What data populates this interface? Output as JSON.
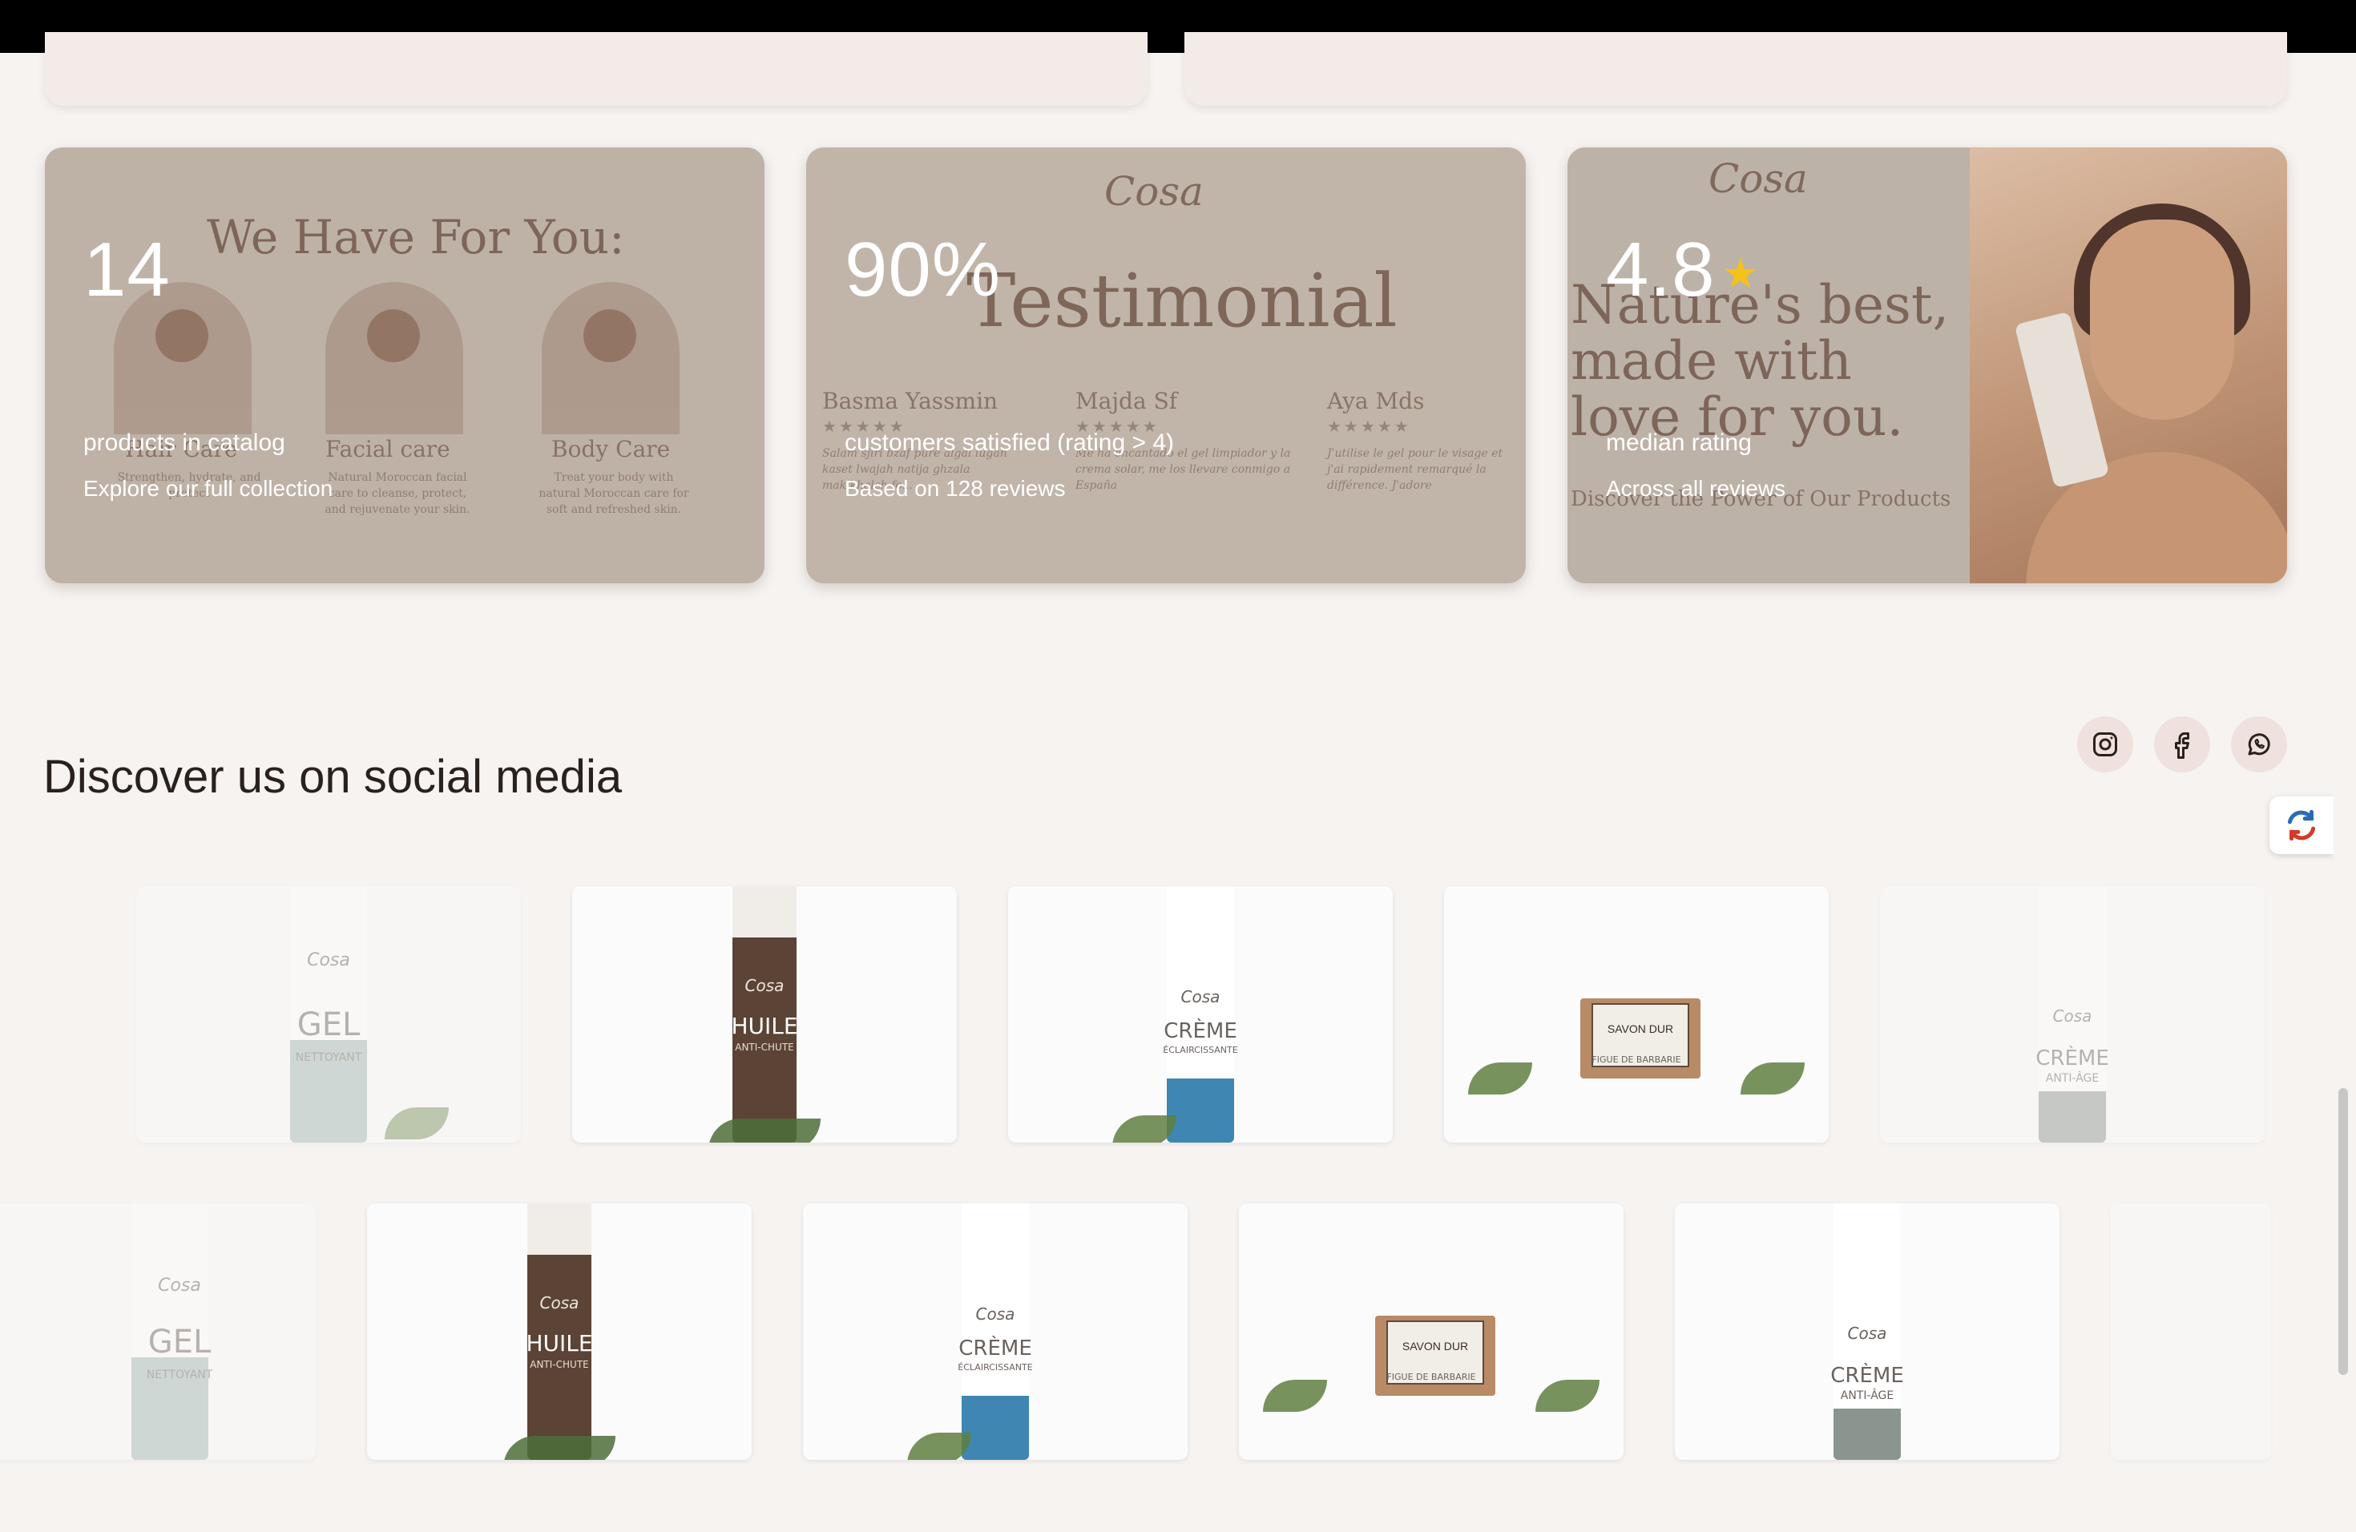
{
  "stats": [
    {
      "value": "14",
      "label": "products in catalog",
      "sub": "Explore our full collection",
      "bg": {
        "title": "We Have For You:",
        "categories": [
          {
            "name": "Hair Care",
            "desc": "Strengthen, hydrate, and protect"
          },
          {
            "name": "Facial care",
            "desc": "Natural Moroccan facial care to cleanse, protect, and rejuvenate your skin."
          },
          {
            "name": "Body Care",
            "desc": "Treat your body with natural Moroccan care for soft and refreshed skin."
          }
        ]
      }
    },
    {
      "value": "90%",
      "label": "customers satisfied (rating > 4)",
      "sub": "Based on 128 reviews",
      "bg": {
        "logo": "Cosa",
        "title": "Testimonial",
        "reviews": [
          {
            "name": "Basma Yassmin",
            "stars": "★★★★★",
            "text": "Salam sjiri bzaf pure algal lugan kaset lwajah natija ghzala makikhalch fo..."
          },
          {
            "name": "Majda Sf",
            "stars": "★★★★★",
            "text": "Me ha encantado el gel limpiador y la crema solar, me los llevare conmigo a España"
          },
          {
            "name": "Aya Mds",
            "stars": "★★★★★",
            "text": "J'utilise le gel pour le visage et j'ai rapidement remarqué la différence. J'adore"
          }
        ]
      }
    },
    {
      "value": "4.8",
      "label": "median rating",
      "sub": "Across all reviews",
      "bg": {
        "logo": "Cosa",
        "tagline": "Nature's best, made with love for you.",
        "caption": "Discover the Power of Our Products"
      }
    }
  ],
  "social": {
    "title": "Discover us on social media",
    "links": [
      "instagram",
      "facebook",
      "whatsapp"
    ]
  },
  "gallery": {
    "row1": [
      {
        "brand": "Cosa",
        "name": "GEL",
        "sub": "NETTOYANT"
      },
      {
        "brand": "Cosa",
        "name": "HUILE",
        "sub": "ANTI-CHUTE"
      },
      {
        "brand": "Cosa",
        "name": "CRÈME",
        "sub": "ÉCLAIRCISSANTE"
      },
      {
        "brand": "Cosa",
        "name": "SAVON DUR",
        "sub": "FIGUE DE BARBARIE"
      },
      {
        "brand": "Cosa",
        "name": "CRÈME",
        "sub": "ANTI-ÂGE"
      }
    ],
    "row2": [
      {
        "brand": "Cosa",
        "name": "GEL",
        "sub": "NETTOYANT"
      },
      {
        "brand": "Cosa",
        "name": "HUILE",
        "sub": "ANTI-CHUTE"
      },
      {
        "brand": "Cosa",
        "name": "CRÈME",
        "sub": "ÉCLAIRCISSANTE"
      },
      {
        "brand": "Cosa",
        "name": "SAVON DUR",
        "sub": "FIGUE DE BARBARIE"
      },
      {
        "brand": "Cosa",
        "name": "CRÈME",
        "sub": "ANTI-ÂGE"
      }
    ]
  },
  "colors": {
    "background": "#f6f3f1",
    "accent_pink": "#efe2de",
    "star": "#f3c21b"
  }
}
